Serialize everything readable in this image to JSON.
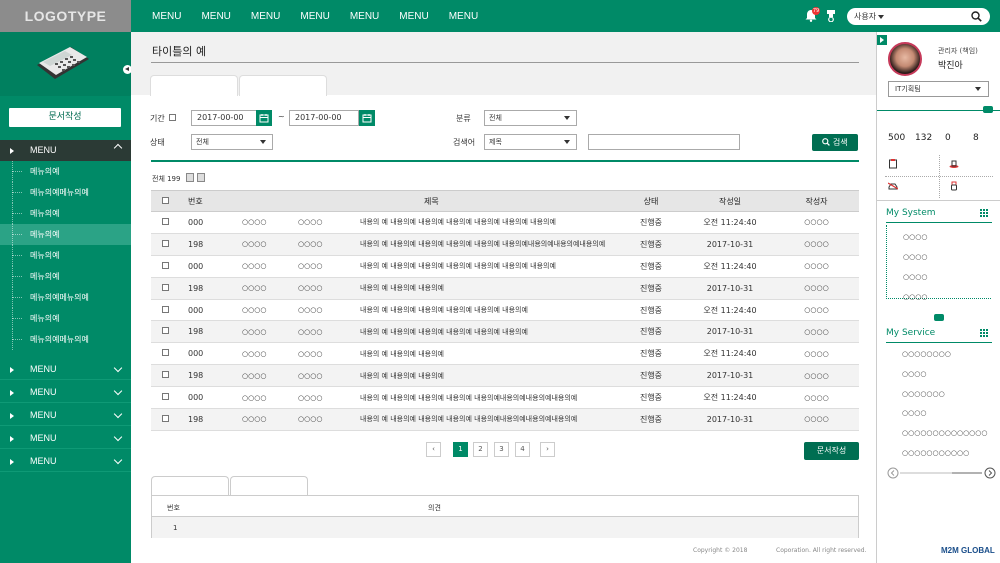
{
  "header": {
    "logo": "LOGOTYPE",
    "menu": [
      "MENU",
      "MENU",
      "MENU",
      "MENU",
      "MENU",
      "MENU",
      "MENU"
    ],
    "notification_count": "79",
    "user_select": "사용자"
  },
  "sidebar": {
    "write_button": "문서작성",
    "menu_head": "MENU",
    "sub_items": [
      "메뉴의예",
      "메뉴의예메뉴의예",
      "메뉴의예",
      "메뉴의예",
      "메뉴의예",
      "메뉴의예",
      "메뉴의예메뉴의예",
      "메뉴의예",
      "메뉴의예메뉴의예"
    ],
    "active_index": 3,
    "menus": [
      "MENU",
      "MENU",
      "MENU",
      "MENU",
      "MENU"
    ]
  },
  "page": {
    "title": "타이틀의 예"
  },
  "filters": {
    "period_label": "기간",
    "date_from": "2017-00-00",
    "tilde": "~",
    "date_to": "2017-00-00",
    "category_label": "분류",
    "category_value": "전체",
    "status_label": "상태",
    "status_value": "전체",
    "keyword_label": "검색어",
    "keyword_value": "제목",
    "search_button": "검색"
  },
  "list": {
    "total_label": "전체 199",
    "headers": {
      "no": "번호",
      "title": "제목",
      "status": "상태",
      "date": "작성일",
      "author": "작성자"
    },
    "rows": [
      {
        "no": "000",
        "c1": "○○○○",
        "c2": "○○○○",
        "title": "내용의 예 내용의예 내용의예 내용의예 내용의예 내용의예 내용의예",
        "status": "진행중",
        "date": "오전 11:24:40",
        "author": "○○○○"
      },
      {
        "no": "198",
        "c1": "○○○○",
        "c2": "○○○○",
        "title": "내용의 예 내용의예 내용의예 내용의예 내용의예 내용의예내용의예내용의예내용의예",
        "status": "진행중",
        "date": "2017-10-31",
        "author": "○○○○"
      },
      {
        "no": "000",
        "c1": "○○○○",
        "c2": "○○○○",
        "title": "내용의 예 내용의예 내용의예 내용의예 내용의예 내용의예 내용의예",
        "status": "진행중",
        "date": "오전 11:24:40",
        "author": "○○○○"
      },
      {
        "no": "198",
        "c1": "○○○○",
        "c2": "○○○○",
        "title": "내용의 예 내용의예 내용의예",
        "status": "진행중",
        "date": "2017-10-31",
        "author": "○○○○"
      },
      {
        "no": "000",
        "c1": "○○○○",
        "c2": "○○○○",
        "title": "내용의 예 내용의예 내용의예 내용의예 내용의예 내용의예",
        "status": "진행중",
        "date": "오전 11:24:40",
        "author": "○○○○"
      },
      {
        "no": "198",
        "c1": "○○○○",
        "c2": "○○○○",
        "title": "내용의 예 내용의예 내용의예 내용의예 내용의예 내용의예",
        "status": "진행중",
        "date": "2017-10-31",
        "author": "○○○○"
      },
      {
        "no": "000",
        "c1": "○○○○",
        "c2": "○○○○",
        "title": "내용의 예 내용의예 내용의예",
        "status": "진행중",
        "date": "오전 11:24:40",
        "author": "○○○○"
      },
      {
        "no": "198",
        "c1": "○○○○",
        "c2": "○○○○",
        "title": "내용의 예 내용의예 내용의예",
        "status": "진행중",
        "date": "2017-10-31",
        "author": "○○○○"
      },
      {
        "no": "000",
        "c1": "○○○○",
        "c2": "○○○○",
        "title": "내용의 예 내용의예 내용의예 내용의예 내용의예내용의예내용의예내용의예",
        "status": "진행중",
        "date": "오전 11:24:40",
        "author": "○○○○"
      },
      {
        "no": "198",
        "c1": "○○○○",
        "c2": "○○○○",
        "title": "내용의 예 내용의예 내용의예 내용의예 내용의예내용의예내용의예내용의예",
        "status": "진행중",
        "date": "2017-10-31",
        "author": "○○○○"
      }
    ]
  },
  "pagination": {
    "prev": "‹",
    "pages": [
      "1",
      "2",
      "3",
      "4"
    ],
    "active": "1",
    "next": "›"
  },
  "bottom": {
    "write_button": "문서작성",
    "comment_headers": {
      "no": "번호",
      "opinion": "의견"
    },
    "comment_row_no": "1"
  },
  "footer": {
    "copyright": "Copyright © 2018",
    "rights": "Coporation. All right reserved."
  },
  "profile": {
    "role": "관리자 (책임)",
    "name": "박진아",
    "dept": "IT기획팀"
  },
  "counters": [
    "500",
    "132",
    "0",
    "8"
  ],
  "my_system": {
    "title": "My System",
    "items": [
      "○○○○",
      "○○○○",
      "○○○○",
      "○○○○"
    ]
  },
  "my_service": {
    "title": "My Service",
    "items": [
      "○○○○○○○○",
      "○○○○",
      "○○○○○○○",
      "○○○○",
      "○○○○○○○○○○○○○○",
      "○○○○○○○○○○○"
    ]
  },
  "brand": "M2M GLOBAL",
  "colors": {
    "primary": "#008a67",
    "dark": "#006e52",
    "menu_head": "#2b3a35"
  }
}
